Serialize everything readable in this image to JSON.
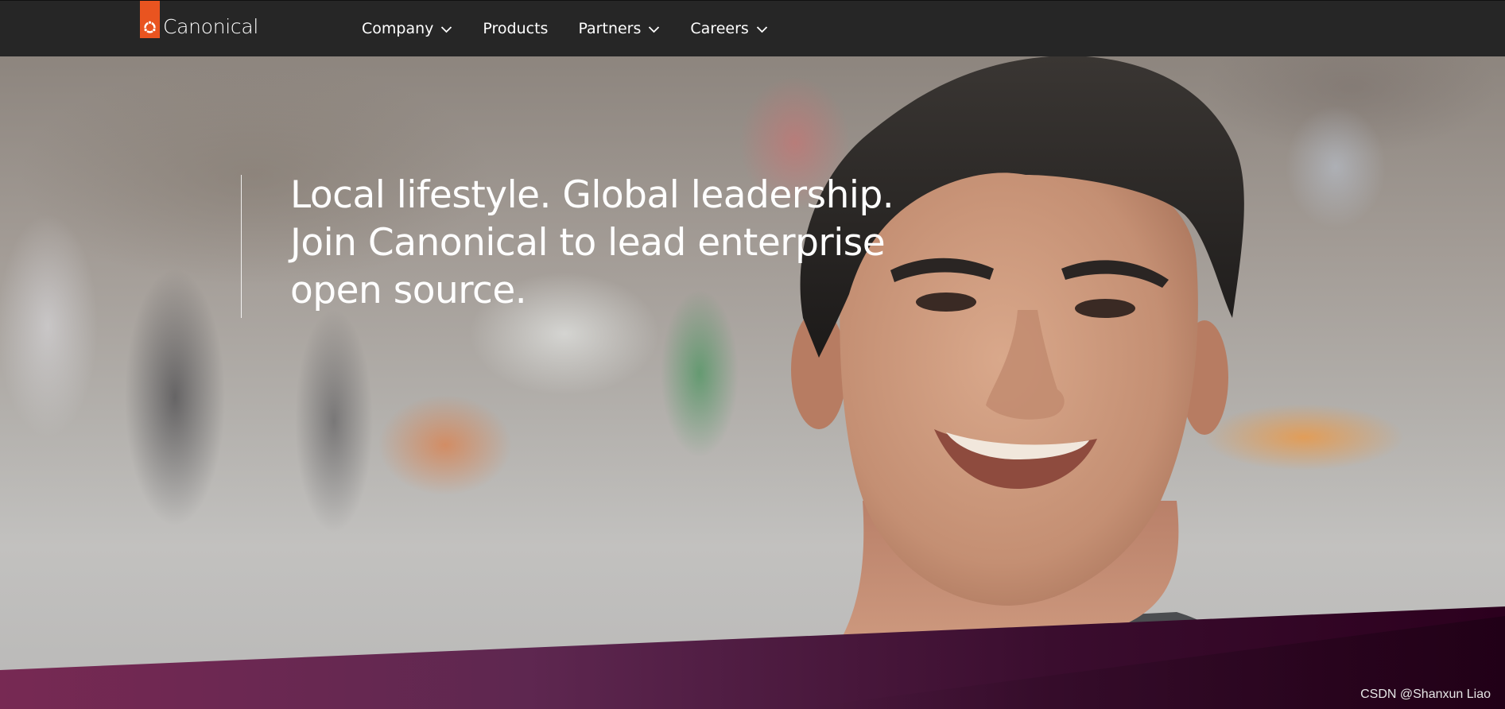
{
  "brand": {
    "name": "Canonical",
    "accent_color": "#e95420",
    "nav_background": "#262626"
  },
  "nav": {
    "items": [
      {
        "label": "Company",
        "has_dropdown": true,
        "icon": "chevron-down-icon"
      },
      {
        "label": "Products",
        "has_dropdown": false
      },
      {
        "label": "Partners",
        "has_dropdown": true,
        "icon": "chevron-down-icon"
      },
      {
        "label": "Careers",
        "has_dropdown": true,
        "icon": "chevron-down-icon"
      }
    ]
  },
  "hero": {
    "headline": "Local lifestyle. Global leadership. Join Canonical to lead enterprise open source.",
    "band_colors": [
      "#772953",
      "#5e2750",
      "#2c001e"
    ]
  },
  "watermark": "CSDN @Shanxun Liao"
}
